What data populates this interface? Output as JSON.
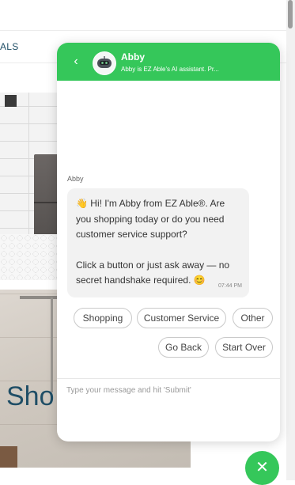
{
  "background": {
    "nav_label": "ALS",
    "headline": "Sho"
  },
  "chat": {
    "header": {
      "back_icon": "chevron-left-icon",
      "back_glyph": "‹",
      "bot_name": "Abby",
      "bot_subtitle": "Abby is EZ Able's AI assistant. Pr...",
      "accent_color": "#35c75a"
    },
    "message": {
      "sender": "Abby",
      "wave_icon": "👋",
      "line1": "Hi! I'm Abby from EZ Able®. Are you shopping today or do you need customer service support?",
      "line2": "Click a button or just ask away — no secret handshake required.",
      "smile_icon": "😊",
      "time": "07:44 PM"
    },
    "quick_replies": {
      "shopping": "Shopping",
      "customer_service": "Customer Service",
      "other": "Other",
      "go_back": "Go Back",
      "start_over": "Start Over"
    },
    "input": {
      "placeholder": "Type your message and hit 'Submit'",
      "value": ""
    },
    "close_icon": "close-icon",
    "close_glyph": "✕"
  }
}
